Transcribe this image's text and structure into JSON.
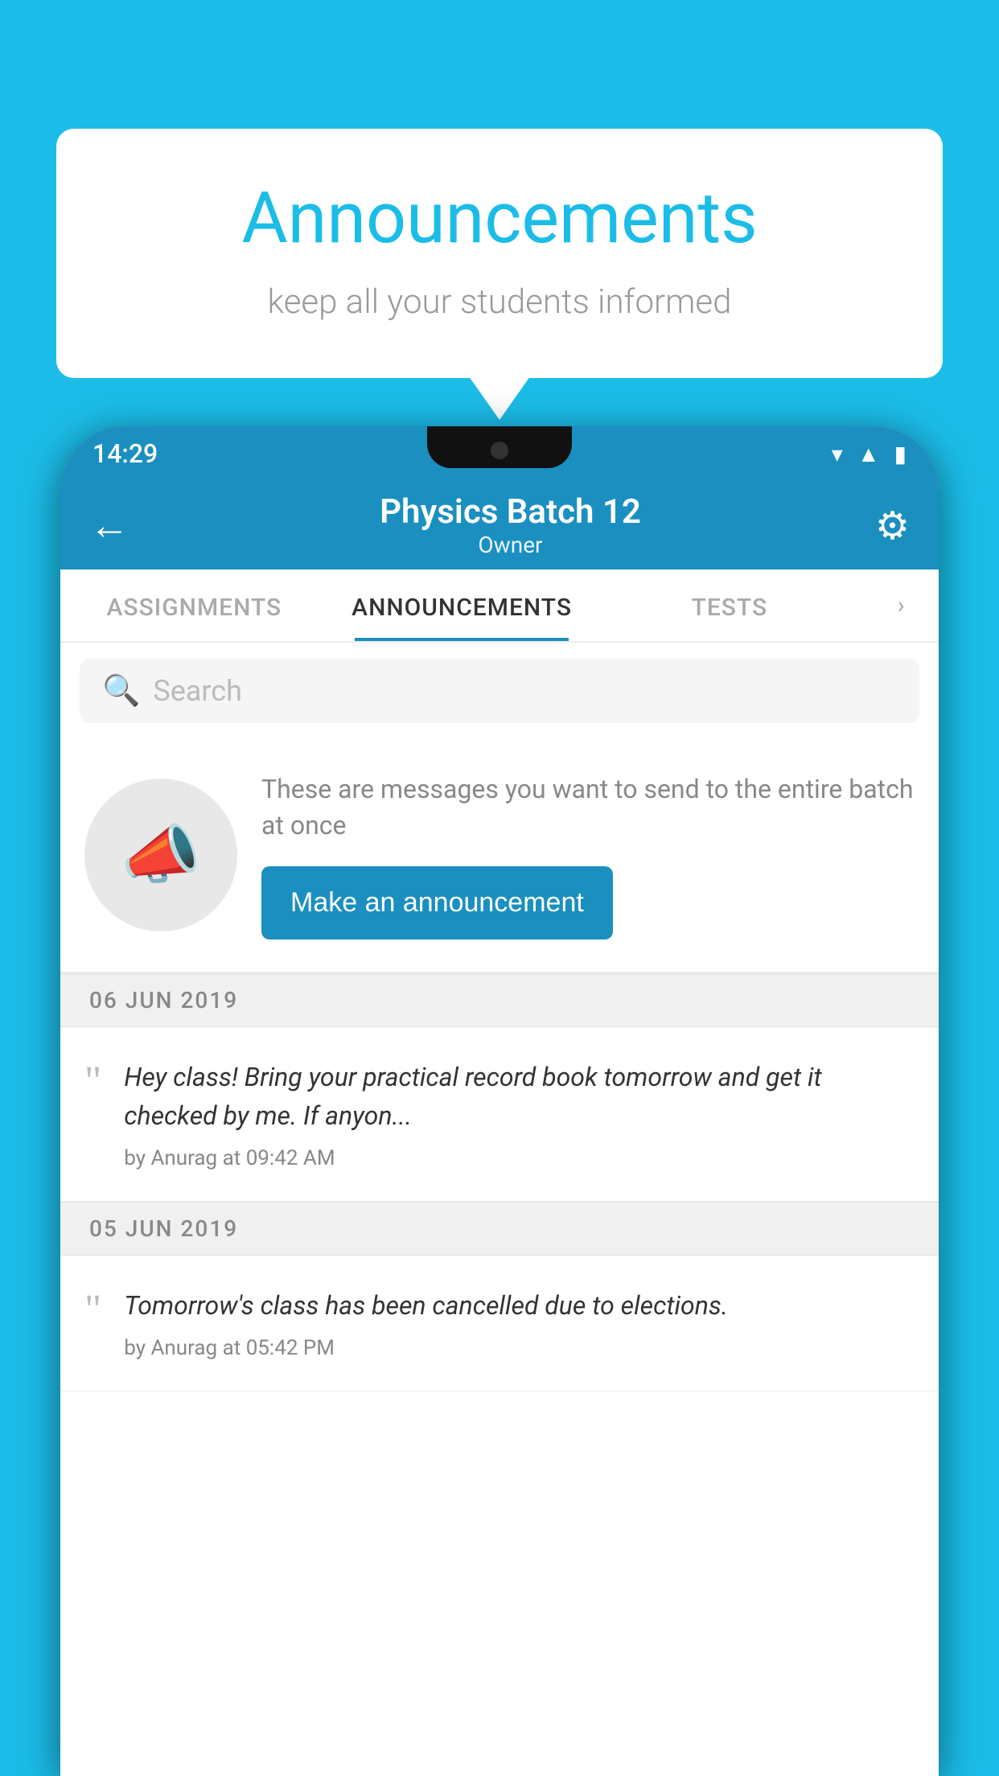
{
  "background_color": "#1bbde8",
  "speech_bubble": {
    "title": "Announcements",
    "subtitle": "keep all your students informed"
  },
  "status_bar": {
    "time": "14:29",
    "icons": [
      "wifi",
      "signal",
      "battery"
    ]
  },
  "app_bar": {
    "title": "Physics Batch 12",
    "subtitle": "Owner",
    "back_label": "←",
    "settings_label": "⚙"
  },
  "tabs": [
    {
      "label": "ASSIGNMENTS",
      "active": false
    },
    {
      "label": "ANNOUNCEMENTS",
      "active": true
    },
    {
      "label": "TESTS",
      "active": false
    }
  ],
  "search": {
    "placeholder": "Search"
  },
  "promo": {
    "description": "These are messages you want to send to the entire batch at once",
    "button_label": "Make an announcement"
  },
  "announcements": [
    {
      "date": "06  JUN  2019",
      "text": "Hey class! Bring your practical record book tomorrow and get it checked by me. If anyon...",
      "meta": "by Anurag at 09:42 AM"
    },
    {
      "date": "05  JUN  2019",
      "text": "Tomorrow's class has been cancelled due to elections.",
      "meta": "by Anurag at 05:42 PM"
    }
  ]
}
